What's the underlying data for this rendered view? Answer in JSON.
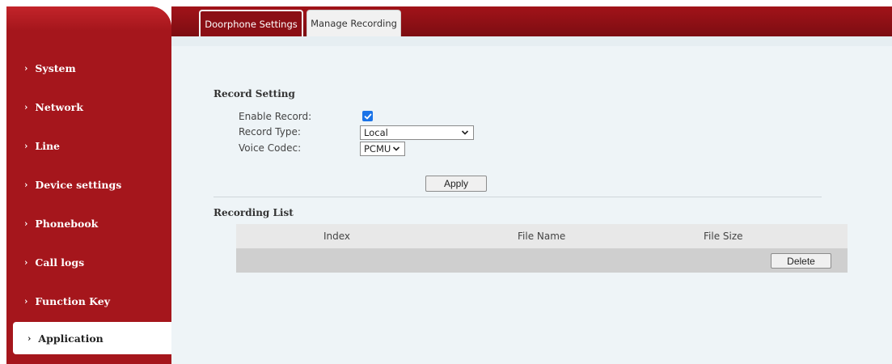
{
  "sidebar": {
    "items": [
      {
        "label": "System"
      },
      {
        "label": "Network"
      },
      {
        "label": "Line"
      },
      {
        "label": "Device settings"
      },
      {
        "label": "Phonebook"
      },
      {
        "label": "Call logs"
      },
      {
        "label": "Function Key"
      },
      {
        "label": "Application",
        "active": true
      }
    ]
  },
  "tabs": [
    {
      "label": "Doorphone Settings",
      "active": false
    },
    {
      "label": "Manage Recording",
      "active": true
    }
  ],
  "record_setting": {
    "title": "Record Setting",
    "enable_label": "Enable Record:",
    "enable_checked": true,
    "type_label": "Record Type:",
    "type_value": "Local",
    "codec_label": "Voice Codec:",
    "codec_value": "PCMU",
    "apply_label": "Apply"
  },
  "recording_list": {
    "title": "Recording List",
    "columns": [
      "Index",
      "File Name",
      "File Size"
    ],
    "delete_label": "Delete"
  },
  "colors": {
    "brand_red": "#a5161c",
    "content_bg": "#eef4f7",
    "checkbox_blue": "#1a73e8"
  }
}
